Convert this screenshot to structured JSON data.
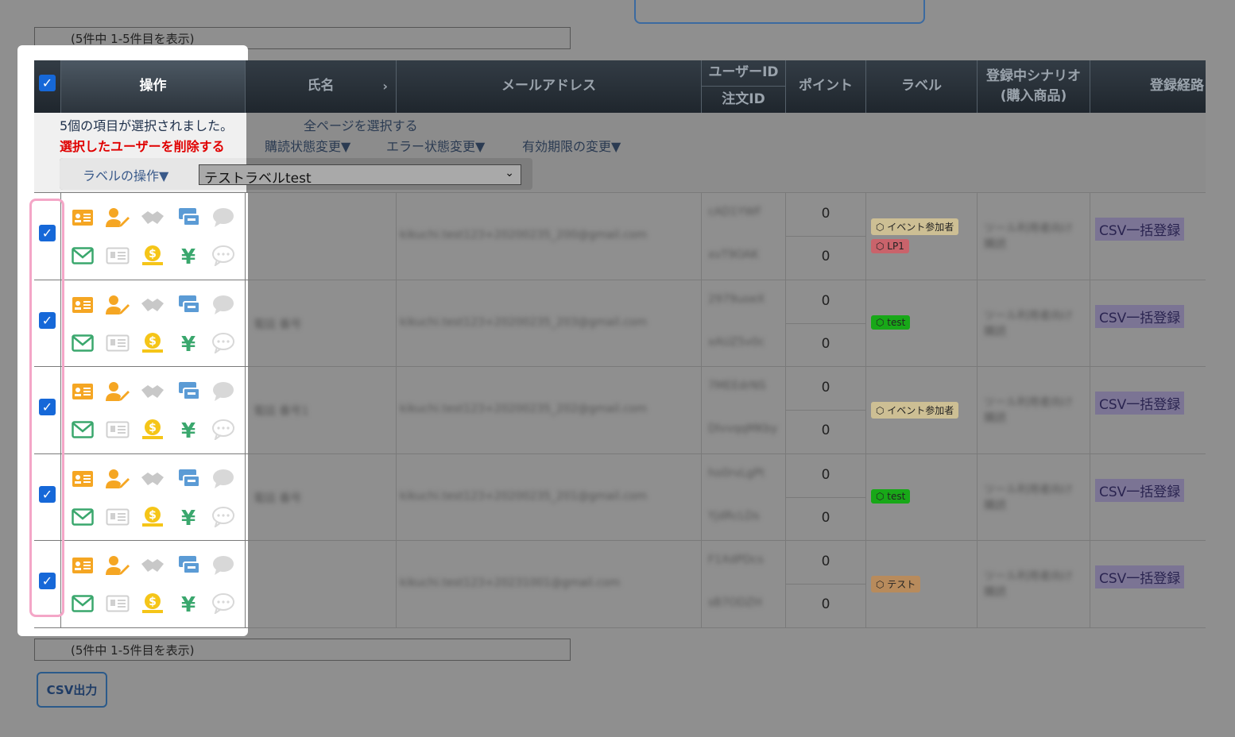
{
  "pagination": {
    "top_text": "(5件中 1-5件目を表示)",
    "bottom_text": "(5件中 1-5件目を表示)"
  },
  "header": {
    "ops": "操作",
    "name": "氏名",
    "name_arrow": "›",
    "email": "メールアドレス",
    "userid": "ユーザーID",
    "orderid": "注文ID",
    "points": "ポイント",
    "label": "ラベル",
    "scenario_1": "登録中シナリオ",
    "scenario_2": "(購入商品)",
    "route": "登録経路"
  },
  "actionbar": {
    "selected_count": "5個の項目が選択されました。",
    "select_all_pages": "全ページを選択する",
    "delete_selected": "選択したユーザーを削除する",
    "subscription_change": "購読状態変更▼",
    "error_change": "エラー状態変更▼",
    "expiry_change": "有効期限の変更▼",
    "label_ops": "ラベルの操作▼",
    "label_select_value": "テストラベルtest"
  },
  "rows": [
    {
      "name": "",
      "email": "kikuchi.test123+20200235_200@gmail.com",
      "userid": "cAD1YWF",
      "orderid": "xvT9OAK",
      "point_1": "0",
      "point_2": "0",
      "labels": [
        "イベント参加者",
        "LP1"
      ],
      "scenario": "ツール利用者向け 購読",
      "route": "CSV一括登録"
    },
    {
      "name": "電話 番号",
      "email": "kikuchi.test123+20200235_203@gmail.com",
      "userid": "2979uoeX",
      "orderid": "xAUZ5v0c",
      "point_1": "0",
      "point_2": "0",
      "labels": [
        "test"
      ],
      "scenario": "ツール利用者向け 購読",
      "route": "CSV一括登録"
    },
    {
      "name": "電話 番号1",
      "email": "kikuchi.test123+20200235_202@gmail.com",
      "userid": "7MEEdrNS",
      "orderid": "DlvvqqMKby",
      "point_1": "0",
      "point_2": "0",
      "labels": [
        "イベント参加者"
      ],
      "scenario": "ツール利用者向け 購読",
      "route": "CSV一括登録"
    },
    {
      "name": "電話 番号",
      "email": "kikuchi.test123+20200235_201@gmail.com",
      "userid": "ho0rvLgPt",
      "orderid": "YjdRcLDs",
      "point_1": "0",
      "point_2": "0",
      "labels": [
        "test"
      ],
      "scenario": "ツール利用者向け 購読",
      "route": "CSV一括登録"
    },
    {
      "name": "",
      "email": "kikuchi.test123+20231001@gmail.com",
      "userid": "F1XdPDcs",
      "orderid": "sB7ODZH",
      "point_1": "0",
      "point_2": "0",
      "labels": [
        "テスト"
      ],
      "scenario": "ツール利用者向け 購読",
      "route": "CSV一括登録"
    }
  ],
  "csv_button": "CSV出力",
  "colors": {
    "checkbox": "#1668d8",
    "highlight_frame": "#f4a6c7",
    "delete_red": "#e00000",
    "icon_orange": "#f5a623",
    "icon_green": "#3aa76d",
    "icon_blue": "#5b9bd5",
    "icon_yellow": "#f5c518",
    "label_event": "#cdbf94",
    "label_lp1": "#c9636b",
    "label_test": "#18a818",
    "label_tesuto": "#b88b5c"
  },
  "icons": [
    "id-card-icon",
    "user-edit-icon",
    "handshake-icon",
    "ticket-icon",
    "chat-icon",
    "mail-icon",
    "receipt-icon",
    "coin-icon",
    "yen-icon",
    "comment-icon"
  ]
}
